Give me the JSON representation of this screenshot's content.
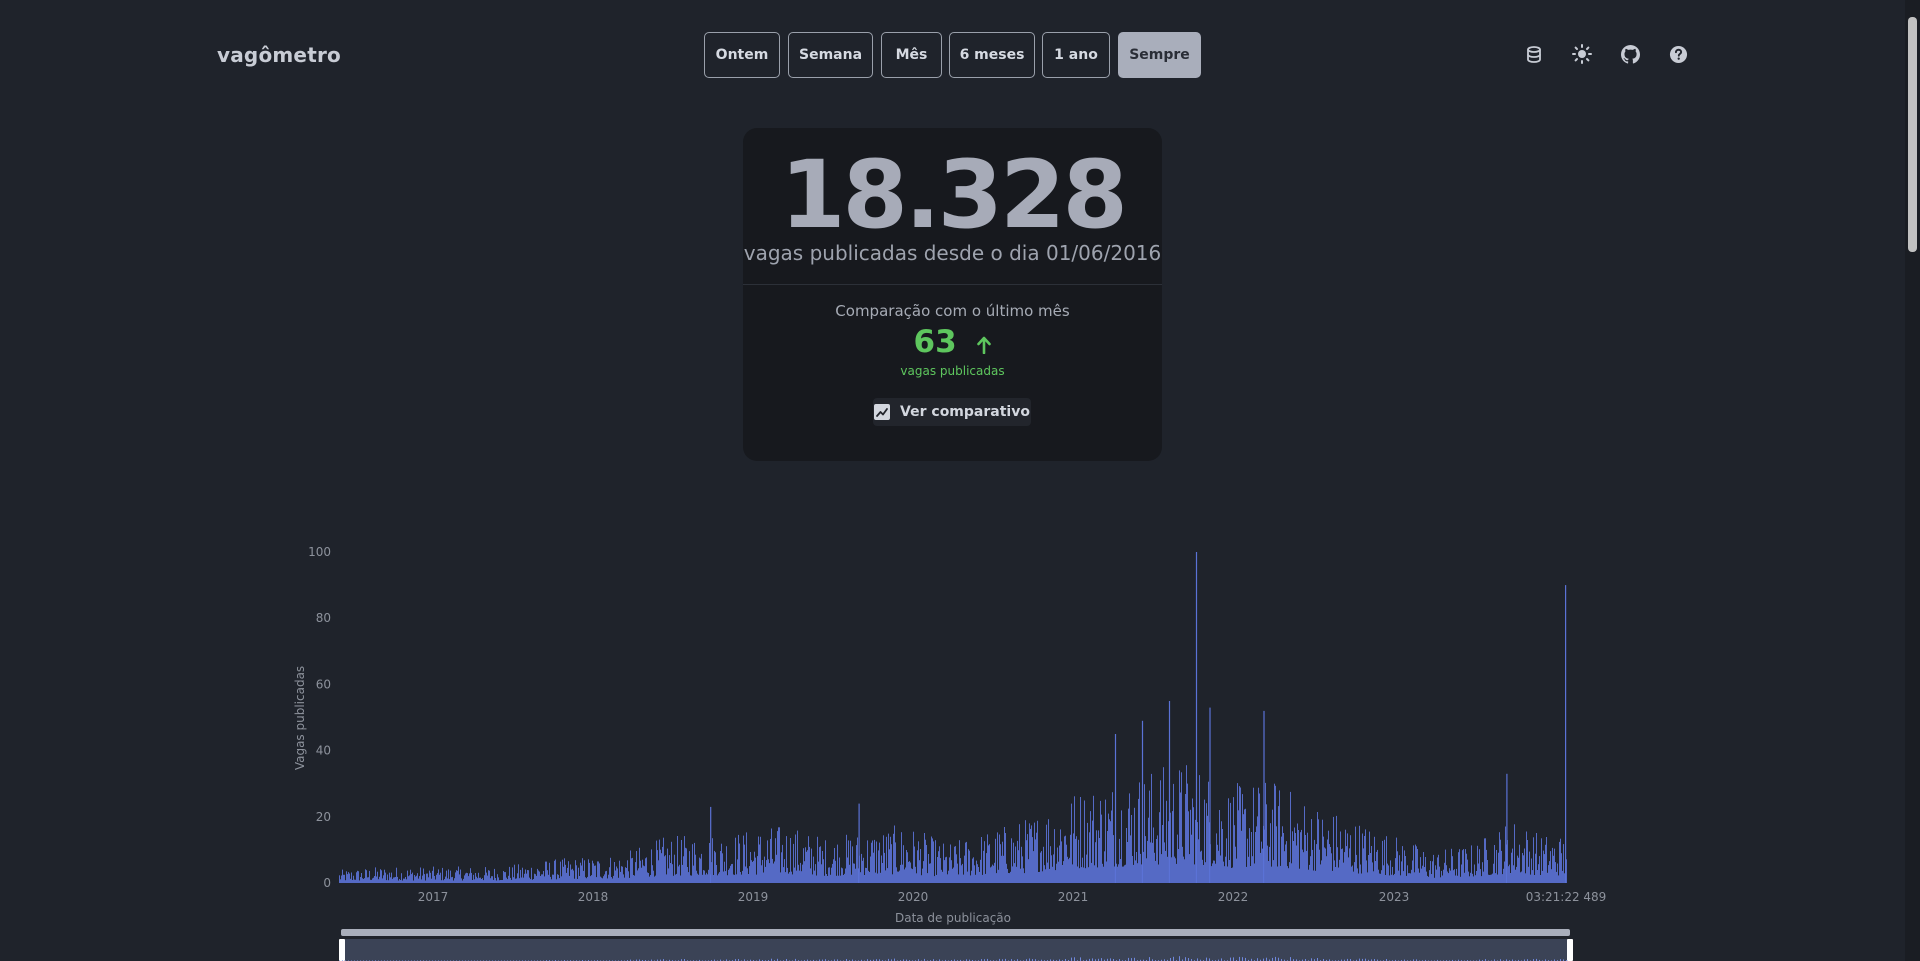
{
  "header": {
    "logo": "vagômetro",
    "periods": [
      {
        "label": "Ontem",
        "active": false
      },
      {
        "label": "Semana",
        "active": false
      },
      {
        "label": "Mês",
        "active": false
      },
      {
        "label": "6 meses",
        "active": false
      },
      {
        "label": "1 ano",
        "active": false
      },
      {
        "label": "Sempre",
        "active": true
      }
    ],
    "icons": [
      "database-icon",
      "sun-icon",
      "github-icon",
      "help-icon"
    ]
  },
  "summary": {
    "total": "18.328",
    "since_text": "vagas publicadas desde o dia 01/06/2016",
    "comparison_title": "Comparação com o último mês",
    "comparison_value": "63",
    "comparison_trend": "up",
    "comparison_label": "vagas publicadas",
    "view_button": "Ver comparativo"
  },
  "colors": {
    "accent_green": "#5ec65e",
    "bar_blue": "#5b72d6",
    "active_button": "#a9aebb"
  },
  "chart_data": {
    "type": "bar",
    "ylabel": "Vagas publicadas",
    "xlabel": "Data de publicação",
    "ylim": [
      0,
      100
    ],
    "yticks": [
      0,
      20,
      40,
      60,
      80,
      100
    ],
    "xticks": [
      "2017",
      "2018",
      "2019",
      "2020",
      "2021",
      "2022",
      "2023",
      "03:21:22 489"
    ],
    "xrange": [
      "2016-06-01",
      "2023-12"
    ],
    "monthly_typical_max": [
      {
        "x": "2016-06",
        "y": 4
      },
      {
        "x": "2016-09",
        "y": 5
      },
      {
        "x": "2016-12",
        "y": 5
      },
      {
        "x": "2017-03",
        "y": 5
      },
      {
        "x": "2017-06",
        "y": 5
      },
      {
        "x": "2017-09",
        "y": 7
      },
      {
        "x": "2017-12",
        "y": 8
      },
      {
        "x": "2018-03",
        "y": 9
      },
      {
        "x": "2018-06",
        "y": 14
      },
      {
        "x": "2018-09",
        "y": 15
      },
      {
        "x": "2018-12",
        "y": 16
      },
      {
        "x": "2019-03",
        "y": 18
      },
      {
        "x": "2019-06",
        "y": 14
      },
      {
        "x": "2019-09",
        "y": 16
      },
      {
        "x": "2019-12",
        "y": 18
      },
      {
        "x": "2020-03",
        "y": 12
      },
      {
        "x": "2020-06",
        "y": 16
      },
      {
        "x": "2020-09",
        "y": 20
      },
      {
        "x": "2020-12",
        "y": 28
      },
      {
        "x": "2021-03",
        "y": 32
      },
      {
        "x": "2021-06",
        "y": 35
      },
      {
        "x": "2021-09",
        "y": 38
      },
      {
        "x": "2021-12",
        "y": 30
      },
      {
        "x": "2022-03",
        "y": 32
      },
      {
        "x": "2022-06",
        "y": 25
      },
      {
        "x": "2022-09",
        "y": 20
      },
      {
        "x": "2022-12",
        "y": 15
      },
      {
        "x": "2023-03",
        "y": 10
      },
      {
        "x": "2023-06",
        "y": 12
      },
      {
        "x": "2023-09",
        "y": 20
      },
      {
        "x": "2023-11",
        "y": 15
      }
    ],
    "spikes": [
      {
        "x": "2021-09",
        "y": 100
      },
      {
        "x": "2023-12",
        "y": 90
      },
      {
        "x": "2021-07",
        "y": 55
      },
      {
        "x": "2021-10",
        "y": 53
      },
      {
        "x": "2022-02",
        "y": 52
      },
      {
        "x": "2021-05",
        "y": 49
      },
      {
        "x": "2021-03",
        "y": 45
      },
      {
        "x": "2023-08",
        "y": 33
      },
      {
        "x": "2019-08",
        "y": 24
      },
      {
        "x": "2018-09",
        "y": 23
      }
    ]
  }
}
